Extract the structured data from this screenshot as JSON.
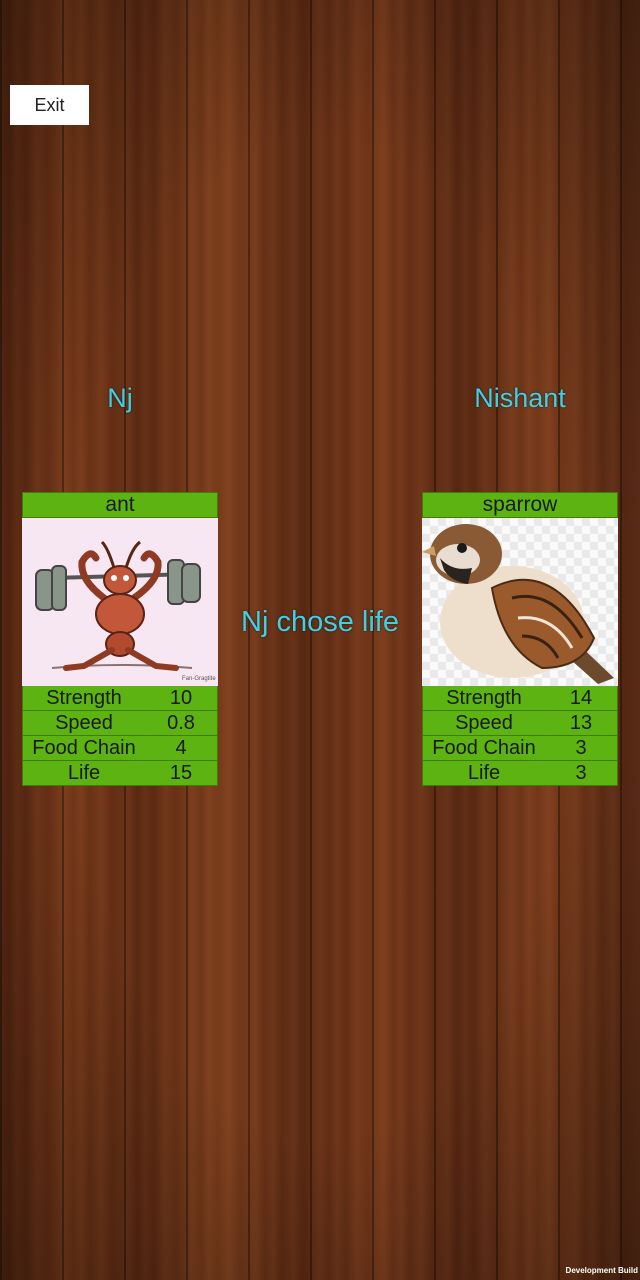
{
  "exit_label": "Exit",
  "players": {
    "left": "Nj",
    "right": "Nishant"
  },
  "message": "Nj chose life",
  "cards": {
    "left": {
      "name": "ant",
      "image_icon": "weightlifting-ant-icon",
      "stats": [
        {
          "label": "Strength",
          "value": "10"
        },
        {
          "label": "Speed",
          "value": "0.8"
        },
        {
          "label": "Food Chain",
          "value": "4"
        },
        {
          "label": "Life",
          "value": "15"
        }
      ]
    },
    "right": {
      "name": "sparrow",
      "image_icon": "sparrow-icon",
      "stats": [
        {
          "label": "Strength",
          "value": "14"
        },
        {
          "label": "Speed",
          "value": "13"
        },
        {
          "label": "Food Chain",
          "value": "3"
        },
        {
          "label": "Life",
          "value": "3"
        }
      ]
    }
  },
  "footer": "Development Build",
  "colors": {
    "card_green": "#5cb312",
    "player_text": "#3fd0e6"
  }
}
